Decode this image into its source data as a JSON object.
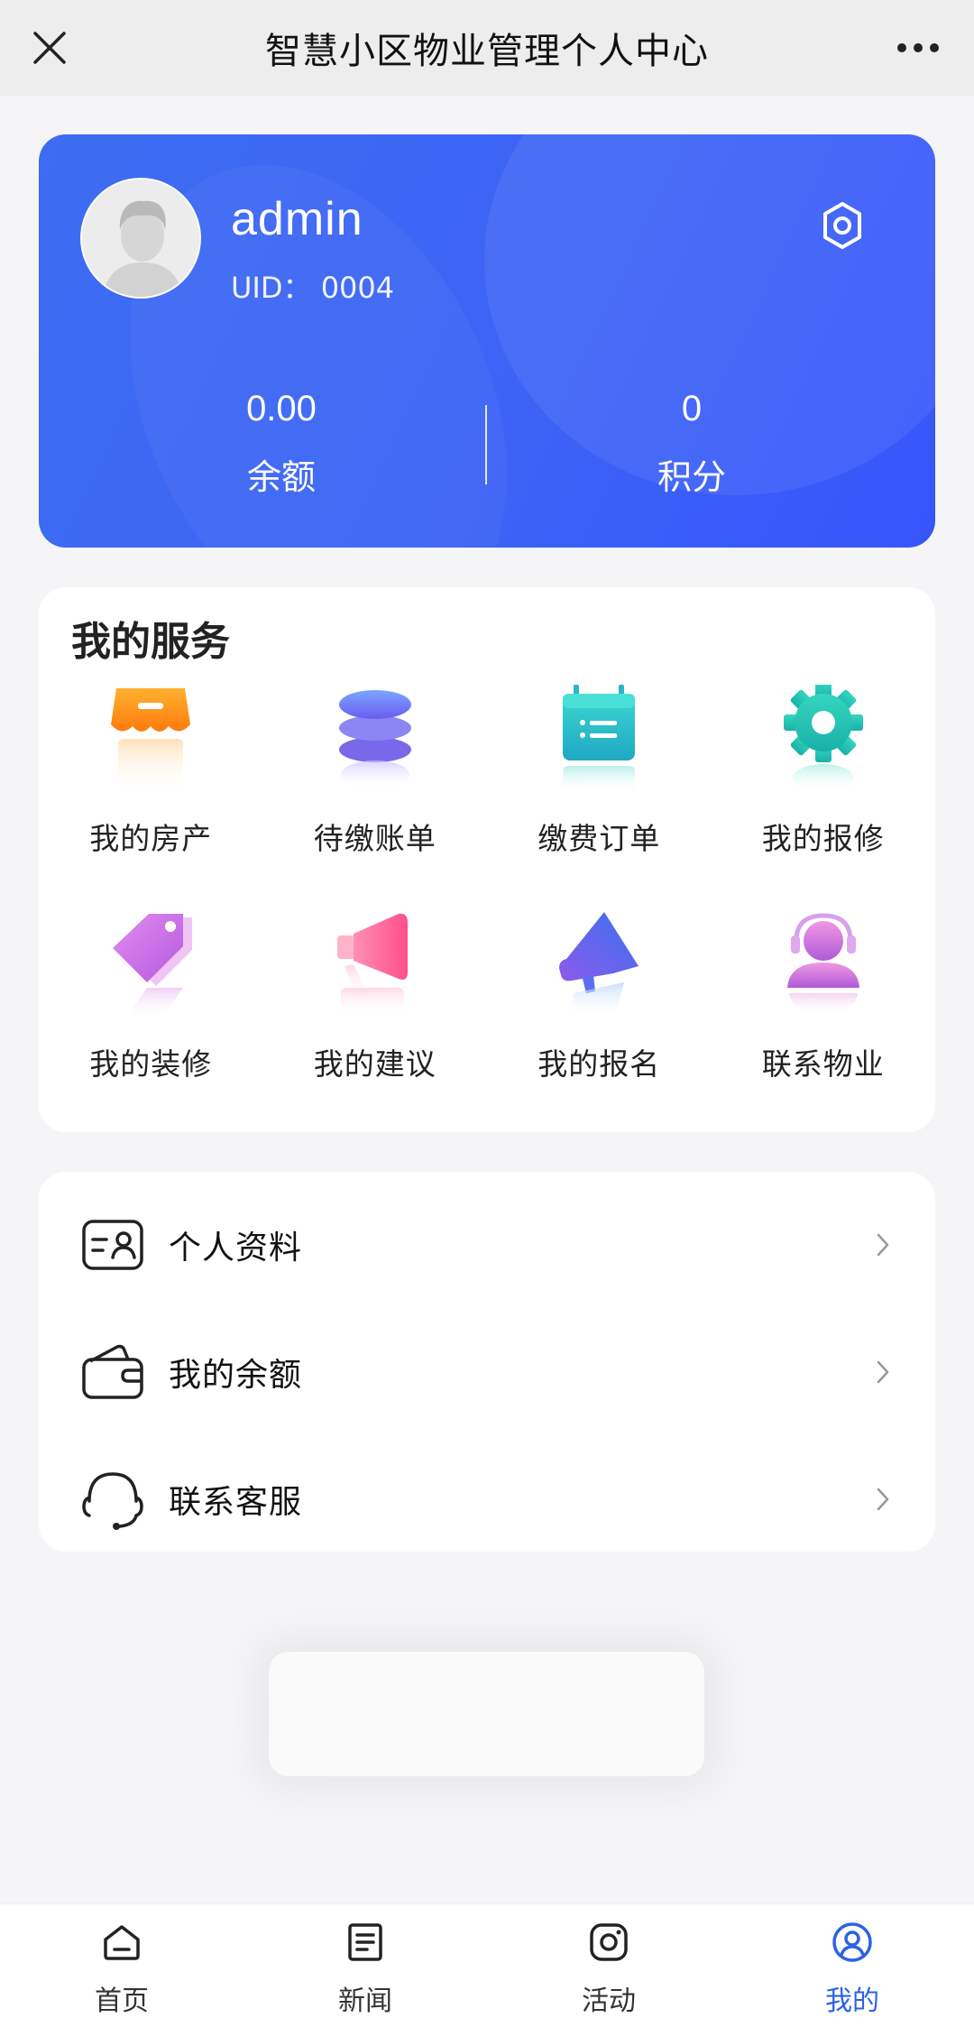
{
  "topbar": {
    "title": "智慧小区物业管理个人中心",
    "close_icon": "close-icon",
    "more_icon": "more-icon"
  },
  "profile": {
    "username": "admin",
    "uid_label": "UID：",
    "uid_value": "0004",
    "balance_value": "0.00",
    "balance_label": "余额",
    "points_value": "0",
    "points_label": "积分",
    "settings_icon": "gear-icon",
    "card_color": "#3c63f6"
  },
  "services": {
    "title": "我的服务",
    "items": [
      {
        "label": "我的房产",
        "icon": "shop-awning-icon"
      },
      {
        "label": "待缴账单",
        "icon": "database-stack-icon"
      },
      {
        "label": "缴费订单",
        "icon": "calendar-list-icon"
      },
      {
        "label": "我的报修",
        "icon": "gear-icon"
      },
      {
        "label": "我的装修",
        "icon": "tag-icon"
      },
      {
        "label": "我的建议",
        "icon": "megaphone-icon"
      },
      {
        "label": "我的报名",
        "icon": "bullhorn-icon"
      },
      {
        "label": "联系物业",
        "icon": "headset-person-icon"
      }
    ]
  },
  "menu": {
    "items": [
      {
        "label": "个人资料",
        "icon": "id-card-icon"
      },
      {
        "label": "我的余额",
        "icon": "wallet-icon"
      },
      {
        "label": "联系客服",
        "icon": "headset-icon"
      }
    ]
  },
  "tabbar": {
    "items": [
      {
        "label": "首页",
        "icon": "home-icon",
        "active": false
      },
      {
        "label": "新闻",
        "icon": "news-icon",
        "active": false
      },
      {
        "label": "活动",
        "icon": "camera-icon",
        "active": false
      },
      {
        "label": "我的",
        "icon": "user-circle-icon",
        "active": true
      }
    ],
    "active_color": "#2d62e6"
  }
}
